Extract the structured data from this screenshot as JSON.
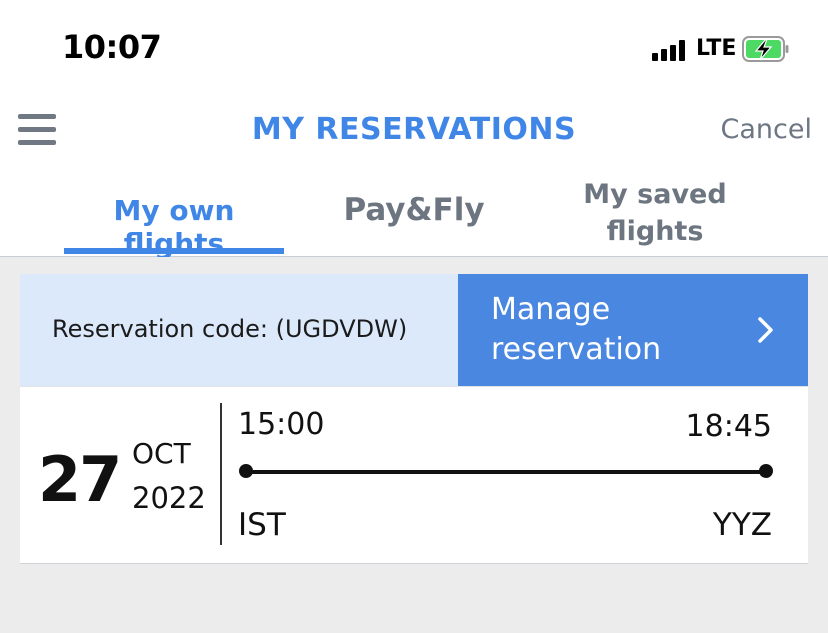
{
  "status_bar": {
    "time": "10:07",
    "network": "LTE",
    "icons": [
      "signal-icon",
      "battery-charging-icon"
    ]
  },
  "header": {
    "title": "MY RESERVATIONS",
    "cancel_label": "Cancel",
    "menu_icon": "hamburger-menu-icon"
  },
  "tabs": [
    {
      "label": "My own flights",
      "active": true
    },
    {
      "label": "Pay&Fly",
      "active": false
    },
    {
      "label": "My saved flights",
      "active": false
    }
  ],
  "reservation": {
    "code_label": "Reservation code: (UGDVDW)",
    "manage_label": "Manage reservation",
    "manage_icon": "chevron-right-icon"
  },
  "flight": {
    "day": "27",
    "month": "OCT",
    "year": "2022",
    "departure_time": "15:00",
    "arrival_time": "18:45",
    "departure_code": "IST",
    "arrival_code": "YYZ"
  },
  "colors": {
    "accent": "#3f86e6",
    "manage_bg": "#4a87e1",
    "code_bg": "#dce9fb",
    "tab_inactive": "#6c7580",
    "battery_green": "#4cd964"
  }
}
